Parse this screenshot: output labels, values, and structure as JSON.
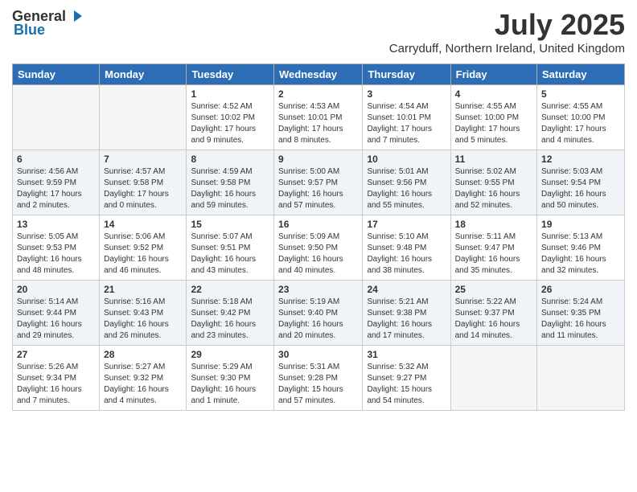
{
  "header": {
    "logo_general": "General",
    "logo_blue": "Blue",
    "title": "July 2025",
    "subtitle": "Carryduff, Northern Ireland, United Kingdom"
  },
  "weekdays": [
    "Sunday",
    "Monday",
    "Tuesday",
    "Wednesday",
    "Thursday",
    "Friday",
    "Saturday"
  ],
  "weeks": [
    [
      {
        "day": "",
        "info": ""
      },
      {
        "day": "",
        "info": ""
      },
      {
        "day": "1",
        "info": "Sunrise: 4:52 AM\nSunset: 10:02 PM\nDaylight: 17 hours\nand 9 minutes."
      },
      {
        "day": "2",
        "info": "Sunrise: 4:53 AM\nSunset: 10:01 PM\nDaylight: 17 hours\nand 8 minutes."
      },
      {
        "day": "3",
        "info": "Sunrise: 4:54 AM\nSunset: 10:01 PM\nDaylight: 17 hours\nand 7 minutes."
      },
      {
        "day": "4",
        "info": "Sunrise: 4:55 AM\nSunset: 10:00 PM\nDaylight: 17 hours\nand 5 minutes."
      },
      {
        "day": "5",
        "info": "Sunrise: 4:55 AM\nSunset: 10:00 PM\nDaylight: 17 hours\nand 4 minutes."
      }
    ],
    [
      {
        "day": "6",
        "info": "Sunrise: 4:56 AM\nSunset: 9:59 PM\nDaylight: 17 hours\nand 2 minutes."
      },
      {
        "day": "7",
        "info": "Sunrise: 4:57 AM\nSunset: 9:58 PM\nDaylight: 17 hours\nand 0 minutes."
      },
      {
        "day": "8",
        "info": "Sunrise: 4:59 AM\nSunset: 9:58 PM\nDaylight: 16 hours\nand 59 minutes."
      },
      {
        "day": "9",
        "info": "Sunrise: 5:00 AM\nSunset: 9:57 PM\nDaylight: 16 hours\nand 57 minutes."
      },
      {
        "day": "10",
        "info": "Sunrise: 5:01 AM\nSunset: 9:56 PM\nDaylight: 16 hours\nand 55 minutes."
      },
      {
        "day": "11",
        "info": "Sunrise: 5:02 AM\nSunset: 9:55 PM\nDaylight: 16 hours\nand 52 minutes."
      },
      {
        "day": "12",
        "info": "Sunrise: 5:03 AM\nSunset: 9:54 PM\nDaylight: 16 hours\nand 50 minutes."
      }
    ],
    [
      {
        "day": "13",
        "info": "Sunrise: 5:05 AM\nSunset: 9:53 PM\nDaylight: 16 hours\nand 48 minutes."
      },
      {
        "day": "14",
        "info": "Sunrise: 5:06 AM\nSunset: 9:52 PM\nDaylight: 16 hours\nand 46 minutes."
      },
      {
        "day": "15",
        "info": "Sunrise: 5:07 AM\nSunset: 9:51 PM\nDaylight: 16 hours\nand 43 minutes."
      },
      {
        "day": "16",
        "info": "Sunrise: 5:09 AM\nSunset: 9:50 PM\nDaylight: 16 hours\nand 40 minutes."
      },
      {
        "day": "17",
        "info": "Sunrise: 5:10 AM\nSunset: 9:48 PM\nDaylight: 16 hours\nand 38 minutes."
      },
      {
        "day": "18",
        "info": "Sunrise: 5:11 AM\nSunset: 9:47 PM\nDaylight: 16 hours\nand 35 minutes."
      },
      {
        "day": "19",
        "info": "Sunrise: 5:13 AM\nSunset: 9:46 PM\nDaylight: 16 hours\nand 32 minutes."
      }
    ],
    [
      {
        "day": "20",
        "info": "Sunrise: 5:14 AM\nSunset: 9:44 PM\nDaylight: 16 hours\nand 29 minutes."
      },
      {
        "day": "21",
        "info": "Sunrise: 5:16 AM\nSunset: 9:43 PM\nDaylight: 16 hours\nand 26 minutes."
      },
      {
        "day": "22",
        "info": "Sunrise: 5:18 AM\nSunset: 9:42 PM\nDaylight: 16 hours\nand 23 minutes."
      },
      {
        "day": "23",
        "info": "Sunrise: 5:19 AM\nSunset: 9:40 PM\nDaylight: 16 hours\nand 20 minutes."
      },
      {
        "day": "24",
        "info": "Sunrise: 5:21 AM\nSunset: 9:38 PM\nDaylight: 16 hours\nand 17 minutes."
      },
      {
        "day": "25",
        "info": "Sunrise: 5:22 AM\nSunset: 9:37 PM\nDaylight: 16 hours\nand 14 minutes."
      },
      {
        "day": "26",
        "info": "Sunrise: 5:24 AM\nSunset: 9:35 PM\nDaylight: 16 hours\nand 11 minutes."
      }
    ],
    [
      {
        "day": "27",
        "info": "Sunrise: 5:26 AM\nSunset: 9:34 PM\nDaylight: 16 hours\nand 7 minutes."
      },
      {
        "day": "28",
        "info": "Sunrise: 5:27 AM\nSunset: 9:32 PM\nDaylight: 16 hours\nand 4 minutes."
      },
      {
        "day": "29",
        "info": "Sunrise: 5:29 AM\nSunset: 9:30 PM\nDaylight: 16 hours\nand 1 minute."
      },
      {
        "day": "30",
        "info": "Sunrise: 5:31 AM\nSunset: 9:28 PM\nDaylight: 15 hours\nand 57 minutes."
      },
      {
        "day": "31",
        "info": "Sunrise: 5:32 AM\nSunset: 9:27 PM\nDaylight: 15 hours\nand 54 minutes."
      },
      {
        "day": "",
        "info": ""
      },
      {
        "day": "",
        "info": ""
      }
    ]
  ]
}
